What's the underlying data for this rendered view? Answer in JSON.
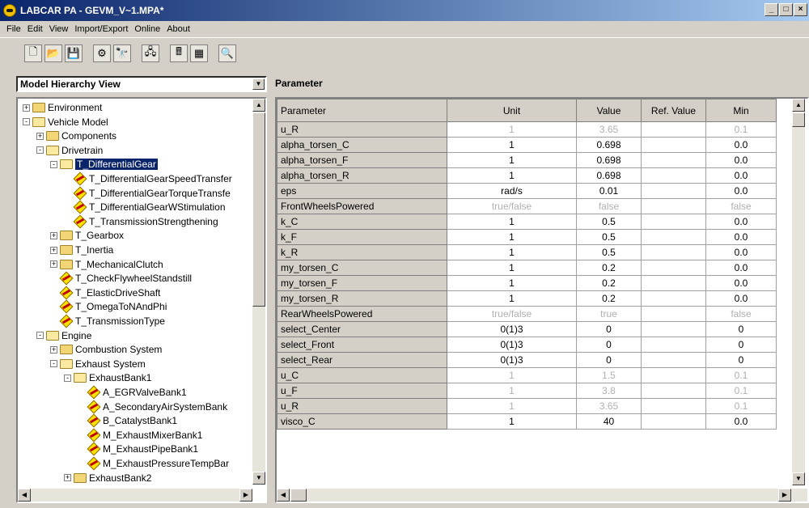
{
  "window": {
    "title": "LABCAR PA - GEVM_V~1.MPA*",
    "controls": [
      "_",
      "□",
      "×"
    ]
  },
  "menu": [
    "File",
    "Edit",
    "View",
    "Import/Export",
    "Online",
    "About"
  ],
  "toolbar": [
    {
      "name": "new-icon",
      "glyph": "🗋"
    },
    {
      "name": "open-icon",
      "glyph": "📂"
    },
    {
      "name": "save-icon",
      "glyph": "💾"
    },
    {
      "sep": true
    },
    {
      "name": "tools-icon",
      "glyph": "⚙"
    },
    {
      "name": "find-icon",
      "glyph": "🔭"
    },
    {
      "sep": true
    },
    {
      "name": "network-icon",
      "glyph": "🖧"
    },
    {
      "sep": true
    },
    {
      "name": "calculator-icon",
      "glyph": "🖩"
    },
    {
      "name": "grid-icon",
      "glyph": "▦"
    },
    {
      "sep": true
    },
    {
      "name": "preview-icon",
      "glyph": "🔍"
    }
  ],
  "hierarchy_select": {
    "value": "Model Hierarchy View"
  },
  "parameter_title": "Parameter",
  "tree": [
    {
      "label": "Environment",
      "level": 0,
      "type": "folder",
      "expander": "+"
    },
    {
      "label": "Vehicle Model",
      "level": 0,
      "type": "folder-open",
      "expander": "-"
    },
    {
      "label": "Components",
      "level": 1,
      "type": "folder",
      "expander": "+"
    },
    {
      "label": "Drivetrain",
      "level": 1,
      "type": "folder-open",
      "expander": "-"
    },
    {
      "label": "T_DifferentialGear",
      "level": 2,
      "type": "folder-open",
      "expander": "-",
      "selected": true
    },
    {
      "label": "T_DifferentialGearSpeedTransfer",
      "level": 3,
      "type": "module"
    },
    {
      "label": "T_DifferentialGearTorqueTransfe",
      "level": 3,
      "type": "module"
    },
    {
      "label": "T_DifferentialGearWStimulation",
      "level": 3,
      "type": "module"
    },
    {
      "label": "T_TransmissionStrengthening",
      "level": 3,
      "type": "module"
    },
    {
      "label": "T_Gearbox",
      "level": 2,
      "type": "folder",
      "expander": "+"
    },
    {
      "label": "T_Inertia",
      "level": 2,
      "type": "folder",
      "expander": "+"
    },
    {
      "label": "T_MechanicalClutch",
      "level": 2,
      "type": "folder",
      "expander": "+"
    },
    {
      "label": "T_CheckFlywheelStandstill",
      "level": 2,
      "type": "module"
    },
    {
      "label": "T_ElasticDriveShaft",
      "level": 2,
      "type": "module"
    },
    {
      "label": "T_OmegaToNAndPhi",
      "level": 2,
      "type": "module"
    },
    {
      "label": "T_TransmissionType",
      "level": 2,
      "type": "module"
    },
    {
      "label": "Engine",
      "level": 1,
      "type": "folder-open",
      "expander": "-"
    },
    {
      "label": "Combustion System",
      "level": 2,
      "type": "folder",
      "expander": "+"
    },
    {
      "label": "Exhaust System",
      "level": 2,
      "type": "folder-open",
      "expander": "-"
    },
    {
      "label": "ExhaustBank1",
      "level": 3,
      "type": "folder-open",
      "expander": "-"
    },
    {
      "label": "A_EGRValveBank1",
      "level": 4,
      "type": "module"
    },
    {
      "label": "A_SecondaryAirSystemBank",
      "level": 4,
      "type": "module"
    },
    {
      "label": "B_CatalystBank1",
      "level": 4,
      "type": "module"
    },
    {
      "label": "M_ExhaustMixerBank1",
      "level": 4,
      "type": "module"
    },
    {
      "label": "M_ExhaustPipeBank1",
      "level": 4,
      "type": "module"
    },
    {
      "label": "M_ExhaustPressureTempBar",
      "level": 4,
      "type": "module"
    },
    {
      "label": "ExhaustBank2",
      "level": 3,
      "type": "folder",
      "expander": "+"
    }
  ],
  "table": {
    "columns": [
      "Parameter",
      "Unit",
      "Value",
      "Ref. Value",
      "Min"
    ],
    "rows": [
      {
        "p": "u_R",
        "u": "1",
        "v": "3.65",
        "r": "",
        "m": "0.1",
        "grey": true
      },
      {
        "p": "alpha_torsen_C",
        "u": "1",
        "v": "0.698",
        "r": "",
        "m": "0.0",
        "grey": false
      },
      {
        "p": "alpha_torsen_F",
        "u": "1",
        "v": "0.698",
        "r": "",
        "m": "0.0",
        "grey": false
      },
      {
        "p": "alpha_torsen_R",
        "u": "1",
        "v": "0.698",
        "r": "",
        "m": "0.0",
        "grey": false
      },
      {
        "p": "eps",
        "u": "rad/s",
        "v": "0.01",
        "r": "",
        "m": "0.0",
        "grey": false
      },
      {
        "p": "FrontWheelsPowered",
        "u": "true/false",
        "v": "false",
        "r": "",
        "m": "false",
        "grey": true
      },
      {
        "p": "k_C",
        "u": "1",
        "v": "0.5",
        "r": "",
        "m": "0.0",
        "grey": false
      },
      {
        "p": "k_F",
        "u": "1",
        "v": "0.5",
        "r": "",
        "m": "0.0",
        "grey": false
      },
      {
        "p": "k_R",
        "u": "1",
        "v": "0.5",
        "r": "",
        "m": "0.0",
        "grey": false
      },
      {
        "p": "my_torsen_C",
        "u": "1",
        "v": "0.2",
        "r": "",
        "m": "0.0",
        "grey": false
      },
      {
        "p": "my_torsen_F",
        "u": "1",
        "v": "0.2",
        "r": "",
        "m": "0.0",
        "grey": false
      },
      {
        "p": "my_torsen_R",
        "u": "1",
        "v": "0.2",
        "r": "",
        "m": "0.0",
        "grey": false
      },
      {
        "p": "RearWheelsPowered",
        "u": "true/false",
        "v": "true",
        "r": "",
        "m": "false",
        "grey": true
      },
      {
        "p": "select_Center",
        "u": "0(1)3",
        "v": "0",
        "r": "",
        "m": "0",
        "grey": false
      },
      {
        "p": "select_Front",
        "u": "0(1)3",
        "v": "0",
        "r": "",
        "m": "0",
        "grey": false
      },
      {
        "p": "select_Rear",
        "u": "0(1)3",
        "v": "0",
        "r": "",
        "m": "0",
        "grey": false
      },
      {
        "p": "u_C",
        "u": "1",
        "v": "1.5",
        "r": "",
        "m": "0.1",
        "grey": true
      },
      {
        "p": "u_F",
        "u": "1",
        "v": "3.8",
        "r": "",
        "m": "0.1",
        "grey": true
      },
      {
        "p": "u_R",
        "u": "1",
        "v": "3.65",
        "r": "",
        "m": "0.1",
        "grey": true
      },
      {
        "p": "visco_C",
        "u": "1",
        "v": "40",
        "r": "",
        "m": "0.0",
        "grey": false
      }
    ]
  }
}
